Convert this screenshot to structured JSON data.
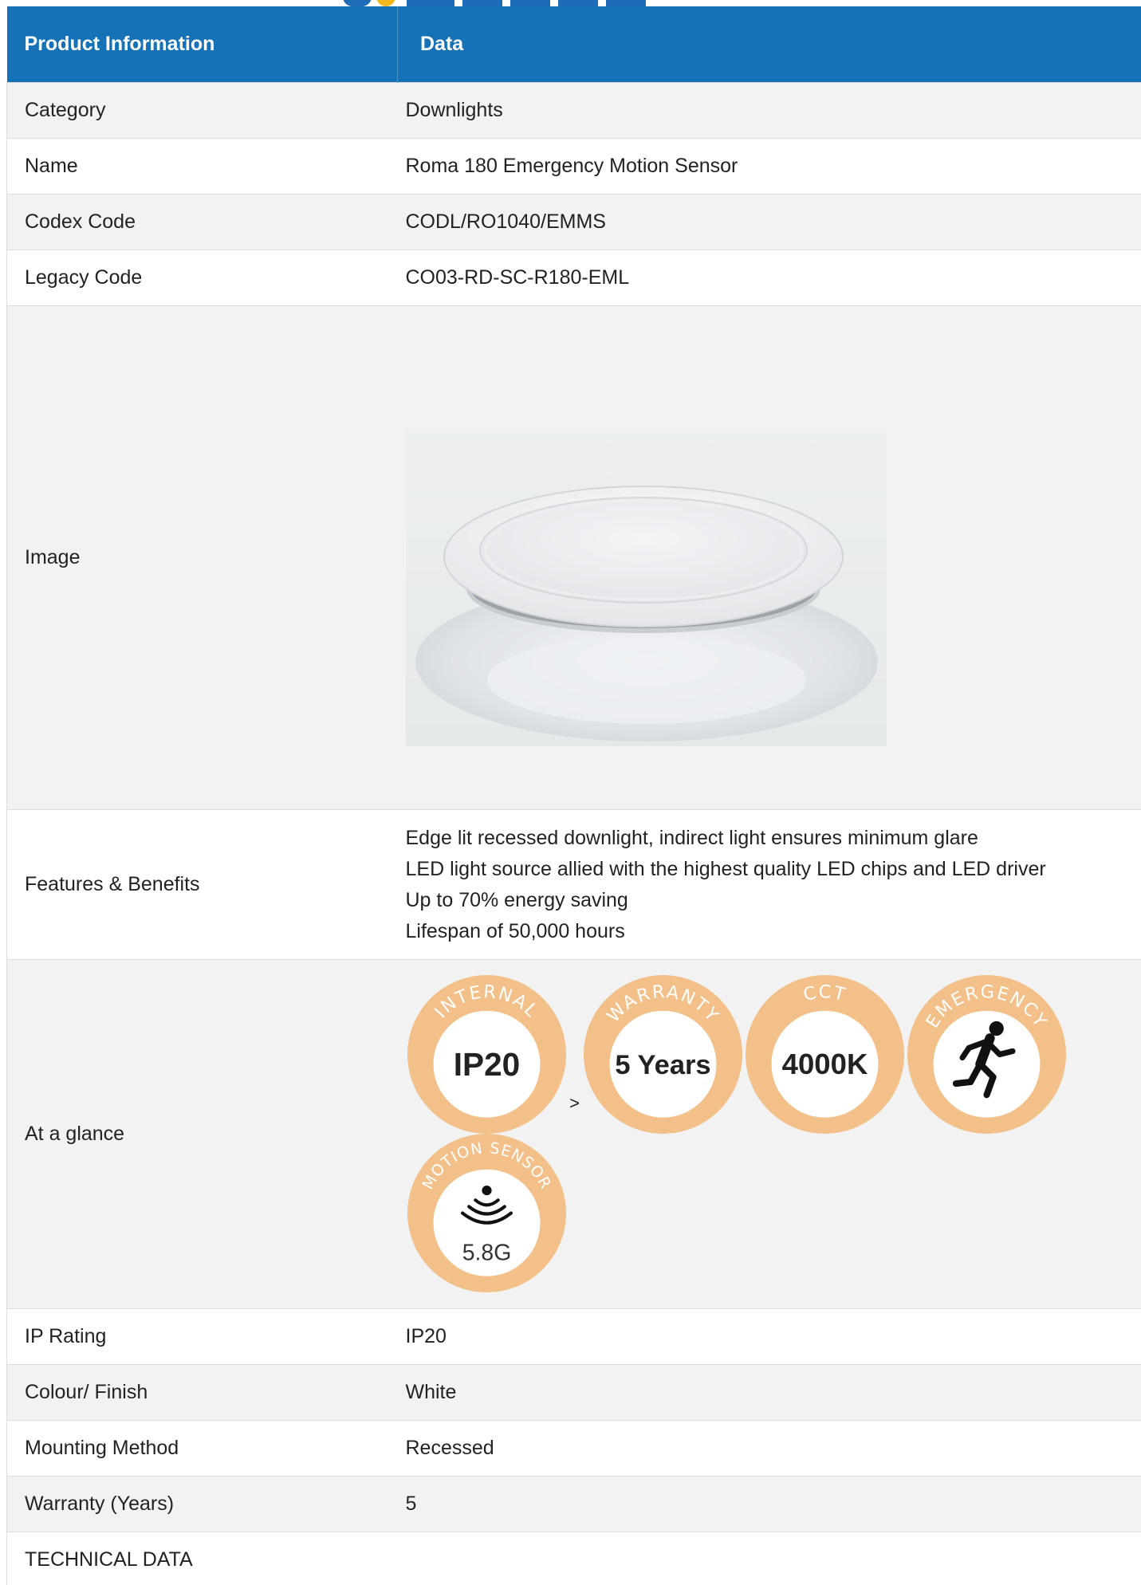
{
  "header": {
    "col1": "Product Information",
    "col2": "Data"
  },
  "rows": {
    "category": {
      "label": "Category",
      "value": "Downlights"
    },
    "name": {
      "label": "Name",
      "value": "Roma 180 Emergency Motion Sensor"
    },
    "codex": {
      "label": "Codex Code",
      "value": "CODL/RO1040/EMMS"
    },
    "legacy": {
      "label": "Legacy Code",
      "value": "CO03-RD-SC-R180-EML"
    },
    "image": {
      "label": "Image"
    },
    "features": {
      "label": "Features & Benefits",
      "lines": [
        "Edge lit recessed downlight, indirect light ensures minimum glare",
        "LED light source allied with the highest quality LED chips and LED driver",
        "Up to 70% energy saving",
        "Lifespan of 50,000 hours"
      ]
    },
    "glance": {
      "label": "At a glance",
      "separator": ">",
      "badges": [
        {
          "arc": "INTERNAL",
          "value": "IP20",
          "icon": "ip-rating-icon"
        },
        {
          "arc": "WARRANTY",
          "value": "5 Years",
          "icon": "warranty-icon"
        },
        {
          "arc": "CCT",
          "value": "4000K",
          "icon": "cct-icon"
        },
        {
          "arc": "EMERGENCY",
          "value": "",
          "icon": "emergency-exit-running-man-icon"
        },
        {
          "arc": "MOTION SENSOR",
          "value": "5.8G",
          "icon": "motion-sensor-icon"
        }
      ]
    },
    "ip": {
      "label": "IP Rating",
      "value": "IP20"
    },
    "colour": {
      "label": "Colour/ Finish",
      "value": "White"
    },
    "mounting": {
      "label": "Mounting Method",
      "value": "Recessed"
    },
    "warranty": {
      "label": "Warranty (Years)",
      "value": "5"
    },
    "technical": {
      "label": "TECHNICAL DATA"
    }
  },
  "colors": {
    "header_bg": "#1572b6",
    "badge_ring": "#f2c088",
    "row_alt": "#f2f2f2"
  }
}
